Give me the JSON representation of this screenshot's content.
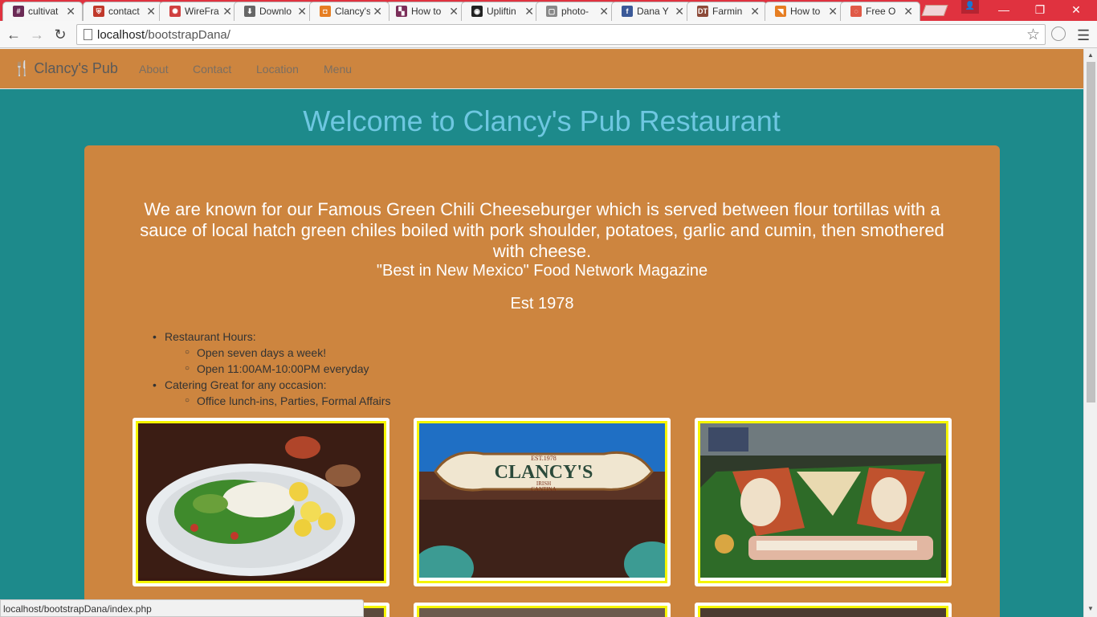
{
  "browser": {
    "tabs": [
      {
        "label": "cultivat",
        "fav": "#",
        "color": "#6a2a55"
      },
      {
        "label": "contact",
        "fav": "⛨",
        "color": "#c0392b"
      },
      {
        "label": "WireFra",
        "fav": "✺",
        "color": "#d04040"
      },
      {
        "label": "Downlo",
        "fav": "⬇",
        "color": "#666666"
      },
      {
        "label": "Clancy's",
        "fav": "◘",
        "color": "#e67e22"
      },
      {
        "label": "How to",
        "fav": "▚",
        "color": "#7b2f5a"
      },
      {
        "label": "Upliftin",
        "fav": "◉",
        "color": "#222222"
      },
      {
        "label": "photo-",
        "fav": "▢",
        "color": "#888888"
      },
      {
        "label": "Dana Y",
        "fav": "f",
        "color": "#3b5998"
      },
      {
        "label": "Farmin",
        "fav": "DT",
        "color": "#8d4b3a"
      },
      {
        "label": "How to",
        "fav": "◥",
        "color": "#e67e22"
      },
      {
        "label": "Free O",
        "fav": "◌",
        "color": "#e05a47"
      }
    ],
    "url_host": "localhost",
    "url_path": "/bootstrapDana/",
    "status_url": "localhost/bootstrapDana/index.php"
  },
  "navbar": {
    "brand": "Clancy's Pub",
    "links": [
      "About",
      "Contact",
      "Location",
      "Menu"
    ]
  },
  "hero": {
    "title": "Welcome to Clancy's Pub Restaurant"
  },
  "panel": {
    "lead": "We are known for our Famous Green Chili Cheeseburger which is served between flour tortillas with a sauce of local hatch green chiles boiled with pork shoulder, potatoes, garlic and cumin, then smothered with cheese.",
    "quote": "\"Best in New Mexico\" Food Network Magazine",
    "est": "Est 1978",
    "hours_title": "Restaurant Hours:",
    "hours_items": [
      "Open seven days a week!",
      "Open 11:00AM-10:00PM everyday"
    ],
    "catering_title": "Catering Great for any occasion:",
    "catering_items": [
      "Office lunch-ins, Parties, Formal Affairs"
    ]
  },
  "sign": {
    "est": "EST.1978",
    "name": "CLANCY'S",
    "sub1": "IRISH",
    "sub2": "CANTINA"
  }
}
